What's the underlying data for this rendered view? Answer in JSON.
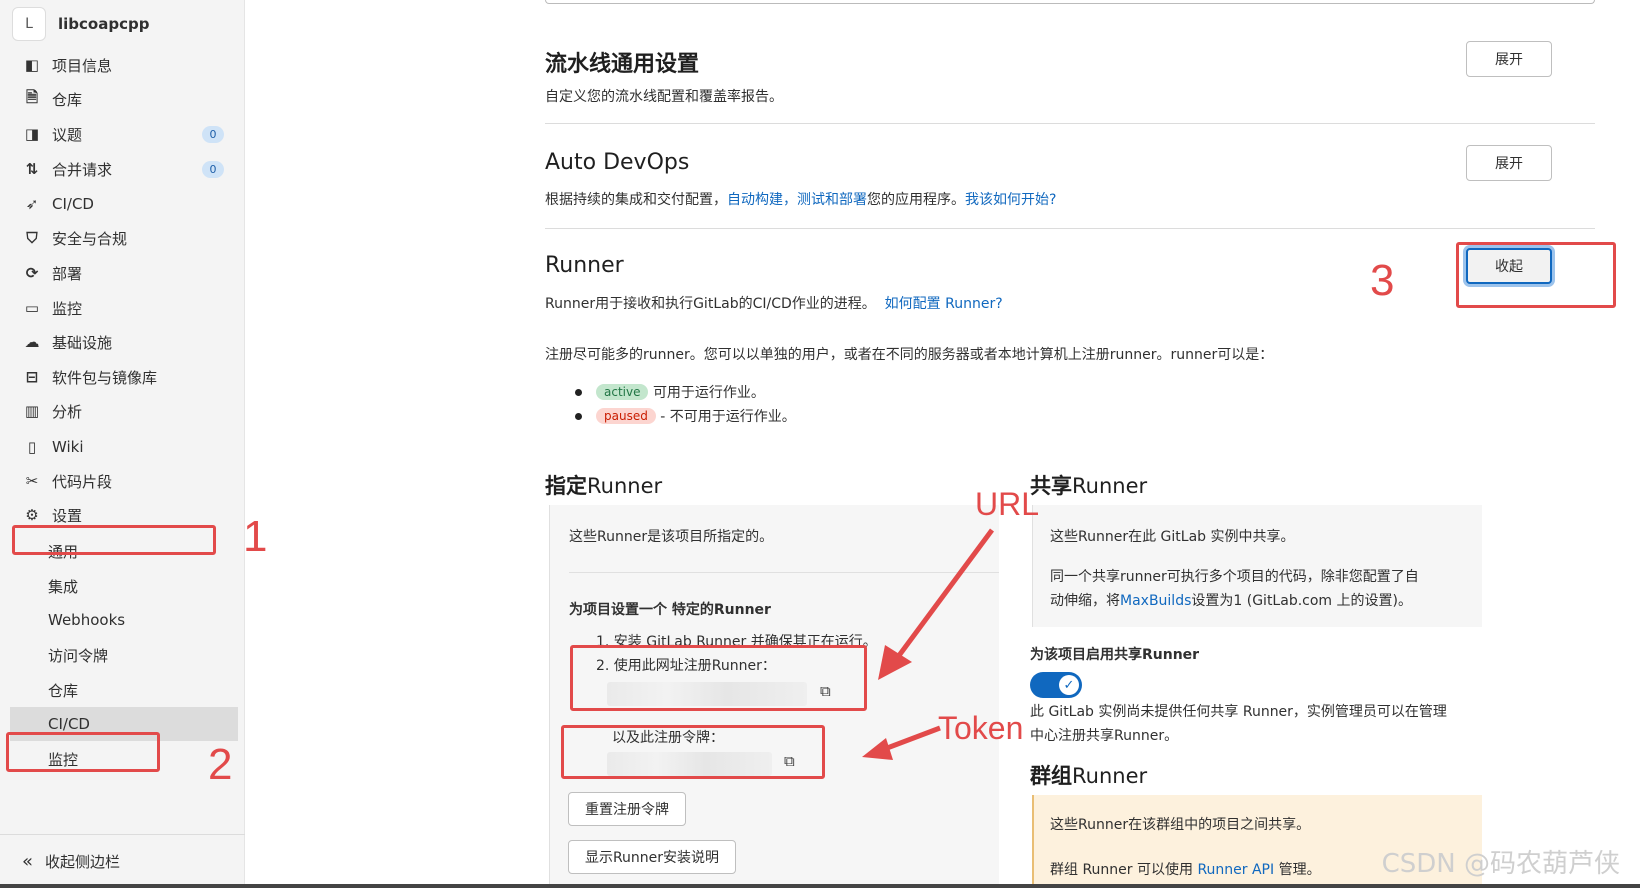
{
  "sidebar": {
    "project_initial": "L",
    "project_name": "libcoapcpp",
    "items": [
      {
        "label": "项目信息",
        "icon": "project-icon"
      },
      {
        "label": "仓库",
        "icon": "repository-icon"
      },
      {
        "label": "议题",
        "icon": "issues-icon",
        "badge": "0"
      },
      {
        "label": "合并请求",
        "icon": "merge-request-icon",
        "badge": "0"
      },
      {
        "label": "CI/CD",
        "icon": "rocket-icon"
      },
      {
        "label": "安全与合规",
        "icon": "shield-icon"
      },
      {
        "label": "部署",
        "icon": "deploy-icon"
      },
      {
        "label": "监控",
        "icon": "monitor-icon"
      },
      {
        "label": "基础设施",
        "icon": "cloud-icon"
      },
      {
        "label": "软件包与镜像库",
        "icon": "package-icon"
      },
      {
        "label": "分析",
        "icon": "chart-icon"
      },
      {
        "label": "Wiki",
        "icon": "book-icon"
      },
      {
        "label": "代码片段",
        "icon": "scissors-icon"
      },
      {
        "label": "设置",
        "icon": "gear-icon"
      }
    ],
    "settings_sub": [
      "通用",
      "集成",
      "Webhooks",
      "访问令牌",
      "仓库",
      "CI/CD",
      "监控"
    ],
    "collapse_label": "收起侧边栏"
  },
  "main": {
    "pipeline": {
      "title": "流水线通用设置",
      "desc": "自定义您的流水线配置和覆盖率报告。",
      "button": "展开"
    },
    "autodevops": {
      "title": "Auto DevOps",
      "desc_prefix": "根据持续的集成和交付配置，",
      "desc_link1": "自动构建，测试和部署",
      "desc_mid": "您的应用程序。",
      "desc_link2": "我该如何开始?",
      "button": "展开"
    },
    "runner": {
      "title": "Runner",
      "desc": "Runner用于接收和执行GitLab的CI/CD作业的进程。",
      "desc_link": "如何配置 Runner?",
      "button": "收起",
      "register_text": "注册尽可能多的runner。您可以以单独的用户，或者在不同的服务器或者本地计算机上注册runner。runner可以是：",
      "status_active": "active",
      "status_active_text": "可用于运行作业。",
      "status_paused": "paused",
      "status_paused_text": "- 不可用于运行作业。"
    },
    "specific": {
      "title_bold": "指定",
      "title_rest": "Runner",
      "panel_text": "这些Runner是该项目所指定的。",
      "setup_title": "为项目设置一个 特定的Runner",
      "step1": "1. 安装 GitLab Runner 并确保其正在运行。",
      "step2": "2. 使用此网址注册Runner：",
      "token_label": "以及此注册令牌：",
      "reset_button": "重置注册令牌",
      "show_button": "显示Runner安装说明"
    },
    "shared": {
      "title_bold": "共享",
      "title_rest": "Runner",
      "text1": "这些Runner在此 GitLab 实例中共享。",
      "text2_a": "同一个共享runner可执行多个项目的代码，除非您配置了自",
      "text2_b": "动伸缩，将",
      "text2_link": "MaxBuilds",
      "text2_c": "设置为1 (GitLab.com 上的设置)。",
      "enable_title": "为该项目启用共享Runner",
      "note_a": "此 GitLab 实例尚未提供任何共享 Runner，实例管理员可以在管理",
      "note_b": "中心注册共享Runner。"
    },
    "group": {
      "title_bold": "群组",
      "title_rest": "Runner",
      "text1": "这些Runner在该群组中的项目之间共享。",
      "text2_a": "群组 Runner 可以使用 ",
      "text2_link": "Runner API",
      "text2_b": " 管理。"
    }
  },
  "annotations": {
    "n1": "1",
    "n2": "2",
    "n3": "3",
    "url": "URL",
    "token": "Token",
    "color": "#e24a4a"
  },
  "watermark": "CSDN @码农葫芦侠"
}
